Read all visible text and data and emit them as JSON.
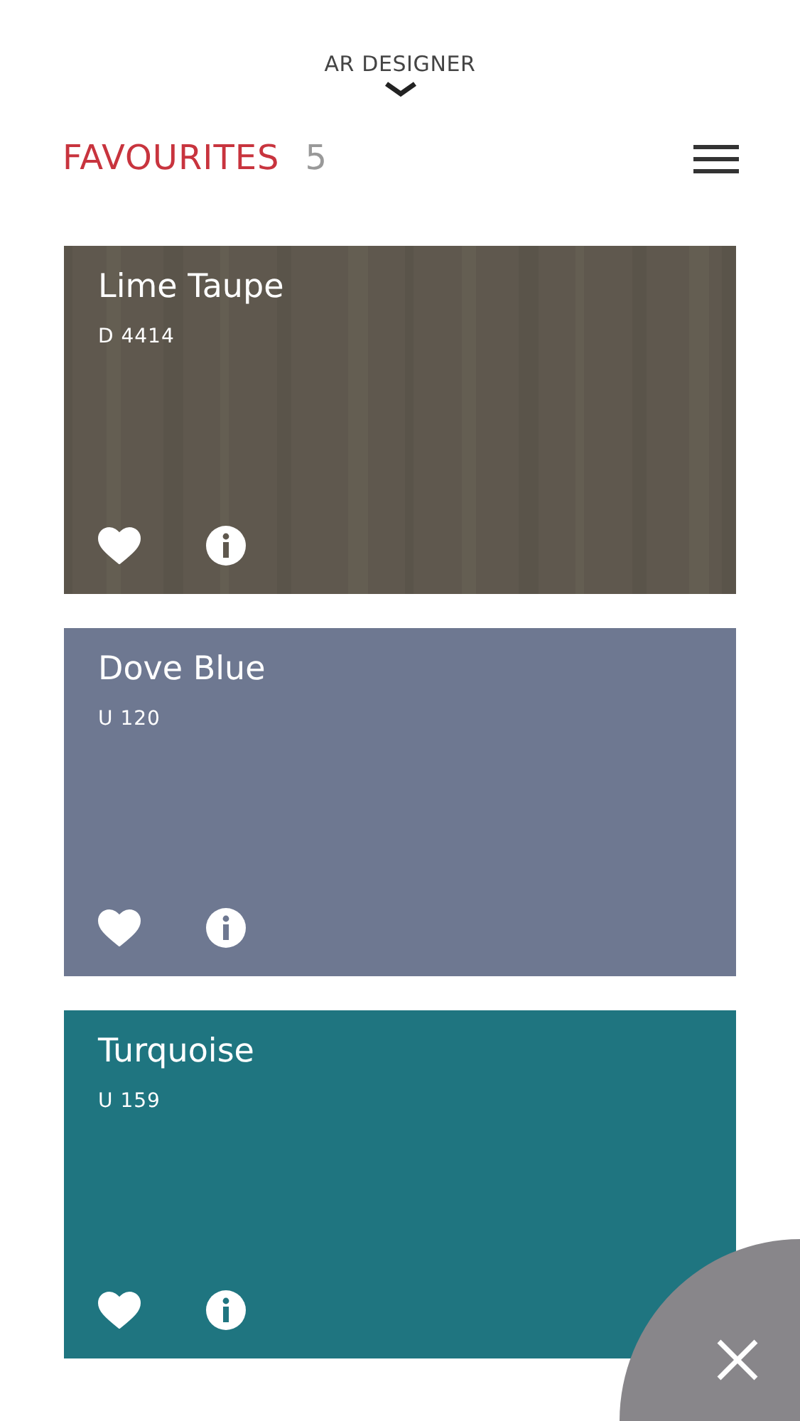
{
  "header": {
    "title": "AR DESIGNER"
  },
  "favourites": {
    "title": "FAVOURITES",
    "count": "5"
  },
  "swatches": [
    {
      "name": "Lime Taupe",
      "code": "D 4414",
      "kind": "wood",
      "color": "#5f584e",
      "favourite": true
    },
    {
      "name": "Dove Blue",
      "code": "U 120",
      "kind": "plain",
      "color": "#6e7891",
      "favourite": true
    },
    {
      "name": "Turquoise",
      "code": "U 159",
      "kind": "plain",
      "color": "#1f7580",
      "favourite": true
    }
  ]
}
